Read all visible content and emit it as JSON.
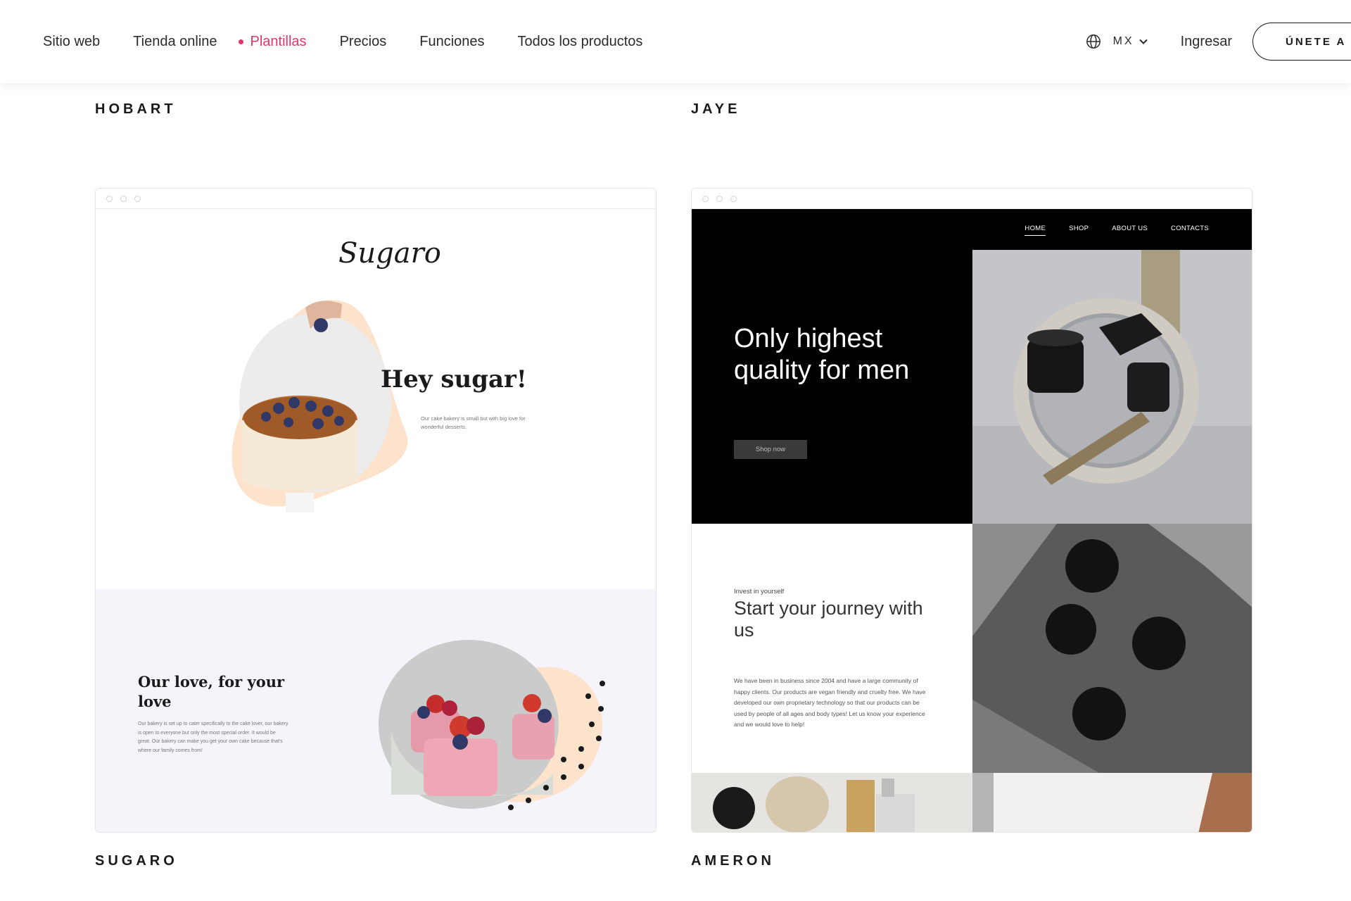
{
  "nav": {
    "items": [
      "Sitio web",
      "Tienda online",
      "Plantillas",
      "Precios",
      "Funciones",
      "Todos los productos"
    ],
    "active_index": 2,
    "lang_code": "MX",
    "login": "Ingresar",
    "join": "ÚNETE A"
  },
  "colors": {
    "accent": "#e8336b",
    "peach": "#fde3cb",
    "lavender": "#f5f4fa"
  },
  "gallery": {
    "top_labels": [
      "HOBART",
      "JAYE"
    ],
    "bottom_labels": [
      "SUGARO",
      "AMERON"
    ]
  },
  "sugaro": {
    "logo": "Sugaro",
    "hero_title": "Hey sugar!",
    "hero_sub": "Our cake bakery is small but with big love for wonderful desserts.",
    "love_title": "Our love, for your love",
    "love_text": "Our bakery is set up to cater specifically to the cake lover, our bakery is open to everyone but only the most special order. It would be great. Our bakery can make you get your own cake because that's where our family comes from!"
  },
  "ameron": {
    "menu": [
      "HOME",
      "SHOP",
      "ABOUT US",
      "CONTACTS"
    ],
    "hero_title": "Only highest quality for men",
    "shop_button": "Shop now",
    "kicker": "Invest in yourself",
    "journey_title": "Start your journey with us",
    "body": "We have been in business since 2004 and have a large community of happy clients. Our products are vegan friendly and cruelty free. We have developed our own proprietary technology so that our products can be used by people of all ages and body types! Let us know your experience and we would love to help!"
  }
}
